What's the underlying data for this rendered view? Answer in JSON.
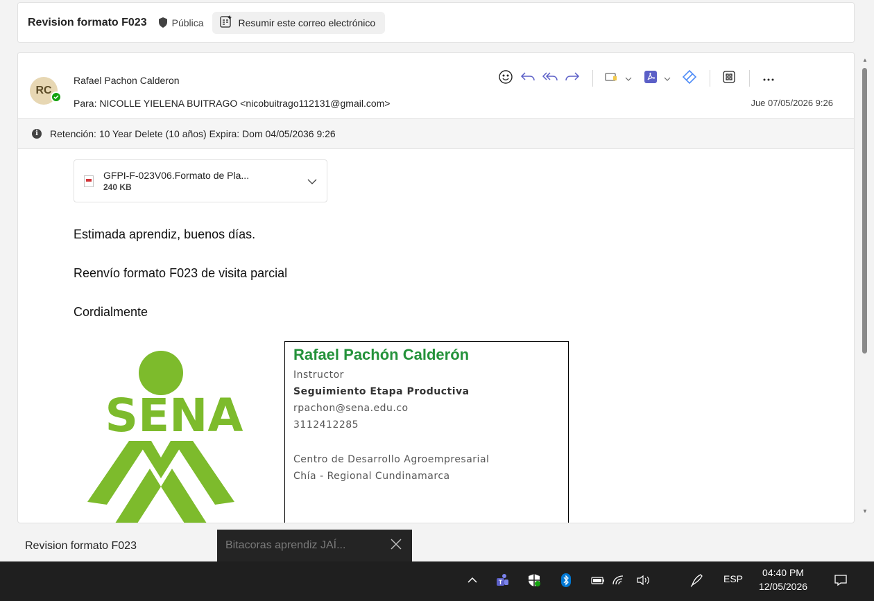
{
  "subject": {
    "title": "Revision formato F023",
    "visibility": "Pública",
    "summarize_label": "Resumir este correo electrónico"
  },
  "message": {
    "avatar_initials": "RC",
    "sender": "Rafael Pachon Calderon",
    "to": "Para:  NICOLLE YIELENA BUITRAGO <nicobuitrago112131@gmail.com>",
    "date": "Jue 07/05/2026 9:26",
    "retention": "Retención: 10 Year Delete (10 años) Expira: Dom 04/05/2036 9:26",
    "attachment": {
      "name": "GFPI-F-023V06.Formato de Pla...",
      "size": "240 KB"
    },
    "body": {
      "greeting": "Estimada aprendiz, buenos días.",
      "line1": "Reenvío formato F023 de visita parcial",
      "closing": "Cordialmente"
    },
    "signature": {
      "logo_text": "SENA",
      "name": "Rafael Pachón Calderón",
      "role": "Instructor",
      "department": "Seguimiento Etapa Productiva",
      "email": "rpachon@sena.edu.co",
      "phone": "3112412285",
      "center": "Centro de Desarrollo Agroempresarial",
      "region": "Chía - Regional Cundinamarca"
    }
  },
  "drafts": {
    "tab1": "Revision formato F023",
    "tab2": "Bitacoras aprendiz JAÍ..."
  },
  "taskbar": {
    "language": "ESP",
    "time": "04:40 PM",
    "date": "12/05/2026"
  },
  "colors": {
    "accent": "#0f6cbd",
    "sena_green": "#7dbb2c",
    "signature_name": "#24923a",
    "presence": "#13a10e"
  }
}
